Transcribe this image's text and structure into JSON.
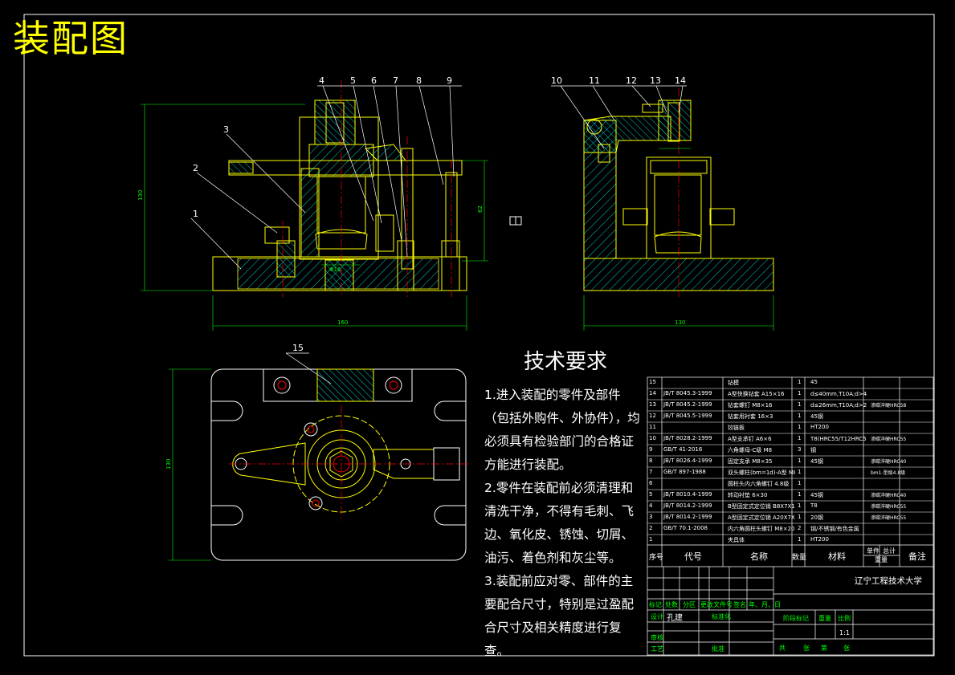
{
  "drawing": {
    "title": "装配图",
    "front_view_labels": [
      "1",
      "2",
      "3",
      "4",
      "5",
      "6",
      "7",
      "8",
      "9"
    ],
    "side_view_labels": [
      "10",
      "11",
      "12",
      "13",
      "14"
    ],
    "top_view_label": "15",
    "dimensions": {
      "front_width": "160",
      "front_height": "130",
      "side_width": "130",
      "top_height": "130",
      "front_inner": "62",
      "bore": "Φ16"
    }
  },
  "tech_requirements": {
    "heading": "技术要求",
    "items": [
      "1.进入装配的零件及部件（包括外购件、外协件），均必须具有检验部门的合格证方能进行装配。",
      "2.零件在装配前必须清理和清洗干净，不得有毛刺、飞边、氧化皮、锈蚀、切屑、油污、着色剂和灰尘等。",
      "3.装配前应对零、部件的主要配合尺寸，特别是过盈配合尺寸及相关精度进行复查。"
    ]
  },
  "bom": {
    "rows": [
      {
        "num": "15",
        "code": "",
        "name": "钻模",
        "qty": "1",
        "mat": "45",
        "note": ""
      },
      {
        "num": "14",
        "code": "JB/T 8045.3-1999",
        "name": "A型快换钻套 A15×16",
        "qty": "1",
        "mat": "d≤40mm,T10A;d>40mm,20钢",
        "note": ""
      },
      {
        "num": "13",
        "code": "JB/T 8045.2-1999",
        "name": "钻套螺钉 M8×16",
        "qty": "1",
        "mat": "d≤26mm,T10A;d>26mm,20钢",
        "note": "渗碳淬硬HRC58"
      },
      {
        "num": "12",
        "code": "JB/T 8045.5-1999",
        "name": "钻套用衬套 16×3",
        "qty": "1",
        "mat": "45钢",
        "note": ""
      },
      {
        "num": "11",
        "code": "",
        "name": "铰链板",
        "qty": "1",
        "mat": "HT200",
        "note": ""
      },
      {
        "num": "10",
        "code": "JB/T 8028.2-1999",
        "name": "A型支承钉 A6×6",
        "qty": "1",
        "mat": "T8(HRC55/T12HRC55后渗碳)",
        "note": "渗碳淬硬HRC55"
      },
      {
        "num": "9",
        "code": "GB/T 41-2016",
        "name": "六角螺母-C级 M8",
        "qty": "3",
        "mat": "钢",
        "note": ""
      },
      {
        "num": "8",
        "code": "JB/T 8026.4-1999",
        "name": "固定支承 M8×35",
        "qty": "1",
        "mat": "45钢",
        "note": "渗碳淬硬HRC40"
      },
      {
        "num": "7",
        "code": "GB/T 897-1988",
        "name": "双头螺柱(bm=1d)-A型 M8×35",
        "qty": "1",
        "mat": "",
        "note": "bm1-型级4.8级"
      },
      {
        "num": "6",
        "code": "",
        "name": "圆柱头内六角螺钉 4.8级",
        "qty": "1",
        "mat": "",
        "note": ""
      },
      {
        "num": "5",
        "code": "JB/T 8010.4-1999",
        "name": "转动衬垫 6×30",
        "qty": "1",
        "mat": "45钢",
        "note": "渗碳淬硬HRC40"
      },
      {
        "num": "4",
        "code": "JB/T 8014.2-1999",
        "name": "B型固定式定位销 B8X7X10",
        "qty": "1",
        "mat": "T8",
        "note": "渗碳淬硬HRC55"
      },
      {
        "num": "3",
        "code": "JB/T 8014.2-1999",
        "name": "A型固定式定位销 A20X7X16",
        "qty": "1",
        "mat": "20钢",
        "note": "渗碳淬硬HRC55"
      },
      {
        "num": "2",
        "code": "GB/T 70.1-2008",
        "name": "内六角圆柱头螺钉 M8×20",
        "qty": "2",
        "mat": "钢/不锈钢/有色金属",
        "note": ""
      },
      {
        "num": "1",
        "code": "",
        "name": "夹具体",
        "qty": "1",
        "mat": "HT200",
        "note": ""
      }
    ],
    "header": {
      "num": "序号",
      "code": "代号",
      "name": "名称",
      "qty": "数量",
      "mat": "材料",
      "unit": "单件",
      "total": "总计",
      "weight": "重量",
      "note": "备注"
    }
  },
  "title_block": {
    "school": "辽宁工程技术大学",
    "labels": {
      "mark": "标记",
      "count": "处数",
      "zone": "分区",
      "change_doc": "更改文件号",
      "sign": "签名",
      "date": "年、月、日",
      "design": "设计",
      "designer": "孔建",
      "std": "标准化",
      "review": "审核",
      "process": "工艺",
      "approve": "批准",
      "stage": "阶段标记",
      "weight": "重量",
      "scale": "比例",
      "scale_val": "1:1",
      "total_sheets": "共",
      "sheets_unit": "张",
      "sheet": "第",
      "sheet_unit": "张"
    }
  },
  "colors": {
    "outline": "#ffffff",
    "solid": "#ffff00",
    "hatch": "#00ffff",
    "dim": "#00ff00",
    "center": "#ff0000",
    "leader": "#ffffff",
    "hidden": "#ff00ff"
  }
}
